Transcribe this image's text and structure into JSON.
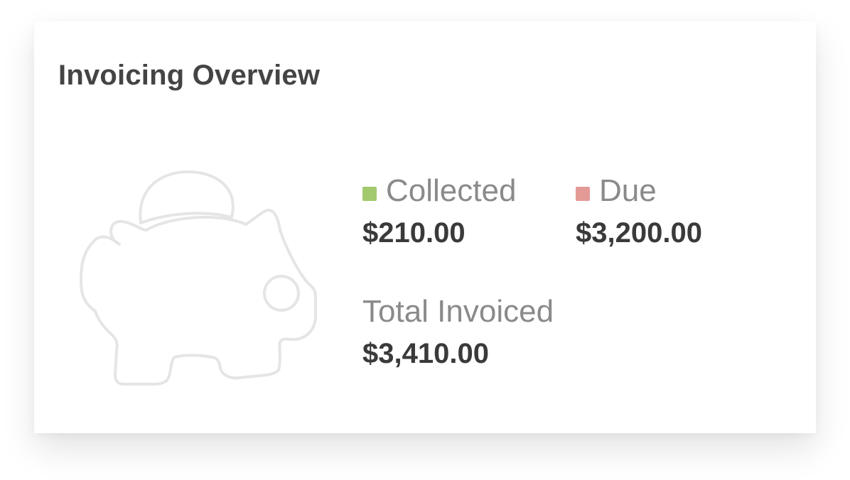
{
  "card": {
    "title": "Invoicing Overview",
    "illustration_icon": "piggy-bank-icon"
  },
  "stats": {
    "collected": {
      "label": "Collected",
      "value": "$210.00",
      "color": "#a3c96e"
    },
    "due": {
      "label": "Due",
      "value": "$3,200.00",
      "color": "#e39a96"
    },
    "total": {
      "label": "Total Invoiced",
      "value": "$3,410.00"
    }
  }
}
